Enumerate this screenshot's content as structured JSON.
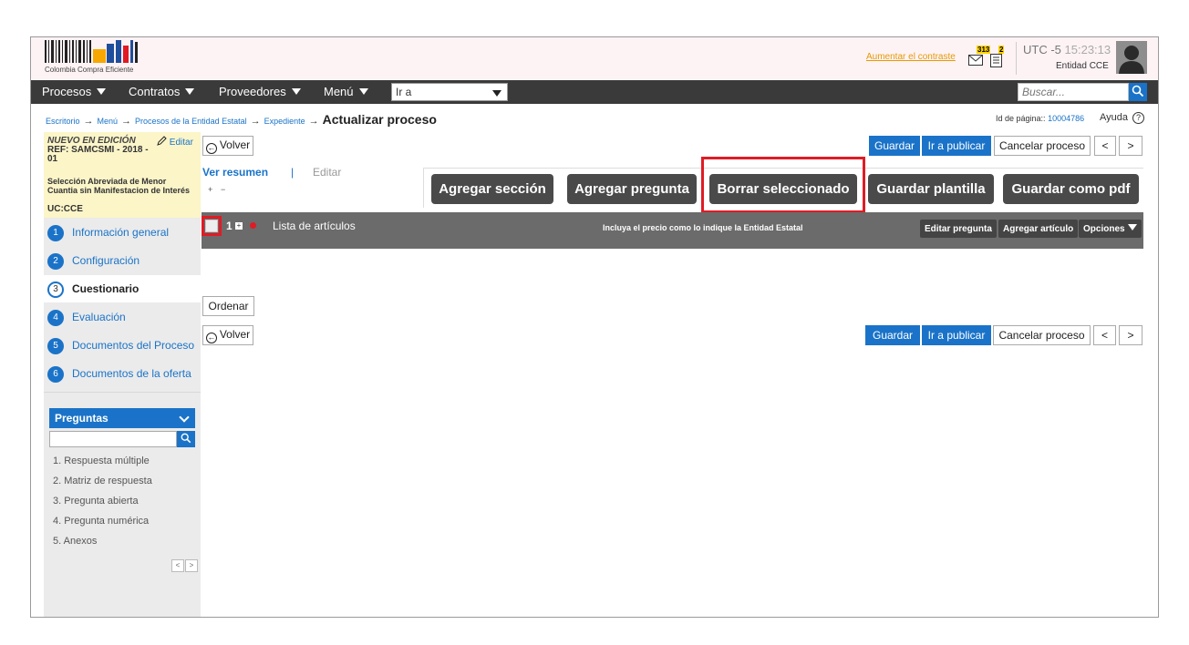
{
  "header": {
    "logo_text": "Colombia Compra Eficiente",
    "contrast_link": "Aumentar el contraste",
    "mail_count": "313",
    "notes_count": "2",
    "timezone": "UTC -5",
    "time": "15:23:13",
    "entity": "Entidad CCE"
  },
  "nav": {
    "items": [
      "Procesos",
      "Contratos",
      "Proveedores",
      "Menú"
    ],
    "goto_label": "Ir a",
    "search_placeholder": "Buscar..."
  },
  "breadcrumb": {
    "items": [
      "Escritorio",
      "Menú",
      "Procesos de la Entidad Estatal",
      "Expediente"
    ],
    "current": "Actualizar proceso"
  },
  "page_id_label": "Id de página::",
  "page_id": "10004786",
  "help_label": "Ayuda",
  "sidebar": {
    "status": "NUEVO EN EDICIÓN",
    "edit_label": "Editar",
    "ref": "REF: SAMCSMI - 2018 - 01",
    "modality": "Selección Abreviada de Menor Cuantia sin Manifestacion de Interés",
    "uc": "UC:CCE",
    "steps": [
      {
        "num": "1",
        "label": "Información general"
      },
      {
        "num": "2",
        "label": "Configuración"
      },
      {
        "num": "3",
        "label": "Cuestionario"
      },
      {
        "num": "4",
        "label": "Evaluación"
      },
      {
        "num": "5",
        "label": "Documentos del Proceso"
      },
      {
        "num": "6",
        "label": "Documentos de la oferta"
      }
    ],
    "questions_header": "Preguntas",
    "questions": [
      "1. Respuesta múltiple",
      "2. Matriz de respuesta",
      "3. Pregunta abierta",
      "4. Pregunta numérica",
      "5. Anexos"
    ]
  },
  "main": {
    "back_label": "Volver",
    "save_label": "Guardar",
    "publish_label": "Ir a publicar",
    "cancel_label": "Cancelar proceso",
    "prev_label": "<",
    "next_label": ">",
    "tab_summary": "Ver resumen",
    "tab_separator": "|",
    "tab_edit": "Editar",
    "expand_label": "+",
    "collapse_label": "−",
    "toolbar": [
      "Agregar sección",
      "Agregar pregunta",
      "Borrar seleccionado",
      "Guardar plantilla",
      "Guardar como pdf"
    ],
    "list_item": {
      "number": "1",
      "title": "Lista de artículos",
      "note": "Incluya el precio como lo indique la Entidad Estatal",
      "edit_question": "Editar pregunta",
      "add_article": "Agregar artículo",
      "options": "Opciones"
    },
    "order_label": "Ordenar"
  },
  "colors": {
    "accent": "#1a73c8",
    "nav_bg": "#3a3a3a",
    "highlight": "#e01b24",
    "status_bg": "#fbf5c8"
  }
}
